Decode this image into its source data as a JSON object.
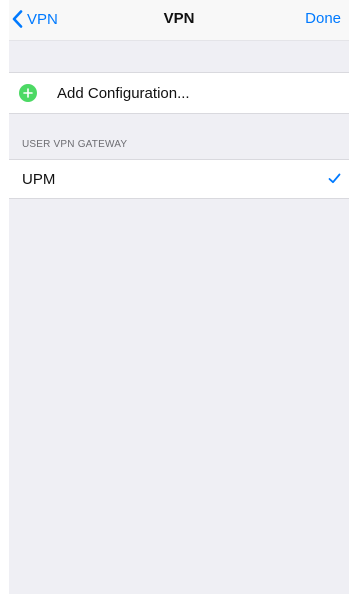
{
  "navbar": {
    "back_label": "VPN",
    "title": "VPN",
    "done_label": "Done"
  },
  "add_configuration": {
    "label": "Add Configuration...",
    "icon": "plus-circle-icon"
  },
  "section": {
    "header": "USER VPN GATEWAY"
  },
  "gateways": [
    {
      "label": "UPM",
      "selected": true
    }
  ],
  "colors": {
    "accent": "#007aff",
    "add_green": "#4cd964",
    "background": "#efeff4"
  }
}
